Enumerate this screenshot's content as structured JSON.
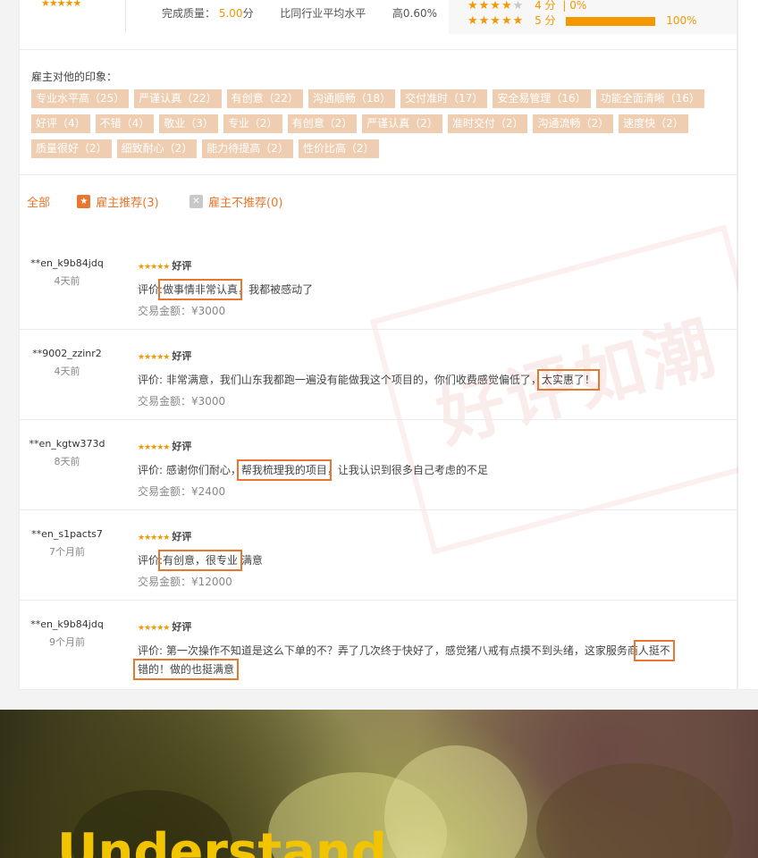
{
  "summary": {
    "stars": "★★★★★",
    "quality_label": "完成质量：",
    "quality_value": "5.00",
    "quality_unit": "分",
    "compare_label": "比同行业平均水平",
    "compare_value": "高0.60%"
  },
  "rating_rows": [
    {
      "stars_on": "★★★★",
      "stars_off": "★",
      "score": "4 分",
      "pct": "0%",
      "fraction": 0
    },
    {
      "stars_on": "★★★★★",
      "stars_off": "",
      "score": "5 分",
      "pct": "100%",
      "fraction": 1
    }
  ],
  "impressions": {
    "title": "雇主对他的印象：",
    "tags": [
      "专业水平高（25）",
      "严谨认真（22）",
      "有创意（22）",
      "沟通顺畅（18）",
      "交付准时（17）",
      "安全易管理（16）",
      "功能全面清晰（16）",
      "好评（4）",
      "不错（4）",
      "敬业（3）",
      "专业（2）",
      "有创意（2）",
      "严谨认真（2）",
      "准时交付（2）",
      "沟通流畅（2）",
      "速度快（2）",
      "质量很好（2）",
      "细致耐心（2）",
      "能力待提高（2）",
      "性价比高（2）"
    ]
  },
  "filters": {
    "all": "全部",
    "recommend": "雇主推荐(3)",
    "not_recommend": "雇主不推荐(0)"
  },
  "reviews": [
    {
      "user": "**en_k9b84jdq",
      "time": "4天前",
      "stars": "★★★★★",
      "grade": "好评",
      "prefix": "评价:",
      "highlight": "做事情非常认真",
      "suffix": "，我都被感动了",
      "amount": "交易金额：¥3000"
    },
    {
      "user": "**9002_zzinr2",
      "time": "4天前",
      "stars": "★★★★★",
      "grade": "好评",
      "prefix": "评价: 非常满意，我们山东我都跑一遍没有能做我这个项目的，你们收费感觉偏低了，",
      "highlight": "太实惠了！",
      "suffix": "",
      "amount": "交易金额：¥3000"
    },
    {
      "user": "**en_kgtw373d",
      "time": "8天前",
      "stars": "★★★★★",
      "grade": "好评",
      "prefix": "评价: 感谢你们耐心，",
      "highlight": "帮我梳理我的项目",
      "suffix": "，让我认识到很多自己考虑的不足",
      "amount": "交易金额：¥2400"
    },
    {
      "user": "**en_s1pacts7",
      "time": "7个月前",
      "stars": "★★★★★",
      "grade": "好评",
      "prefix": "评价:",
      "highlight": "有创意，很专业",
      "suffix": " 满意",
      "amount": "交易金额：¥12000"
    },
    {
      "user": "**en_k9b84jdq",
      "time": "9个月前",
      "stars": "★★★★★",
      "grade": "好评",
      "prefix": "评价: 第一次操作不知道是这么下单的不？弄了几次终于快好了，感觉猪八戒有点摸不到头绪，这家服务商",
      "highlight": "人挺不错的！做的也挺满意",
      "suffix": "",
      "amount": ""
    }
  ],
  "watermark": "好评如潮",
  "banner": {
    "text": "Understand"
  }
}
